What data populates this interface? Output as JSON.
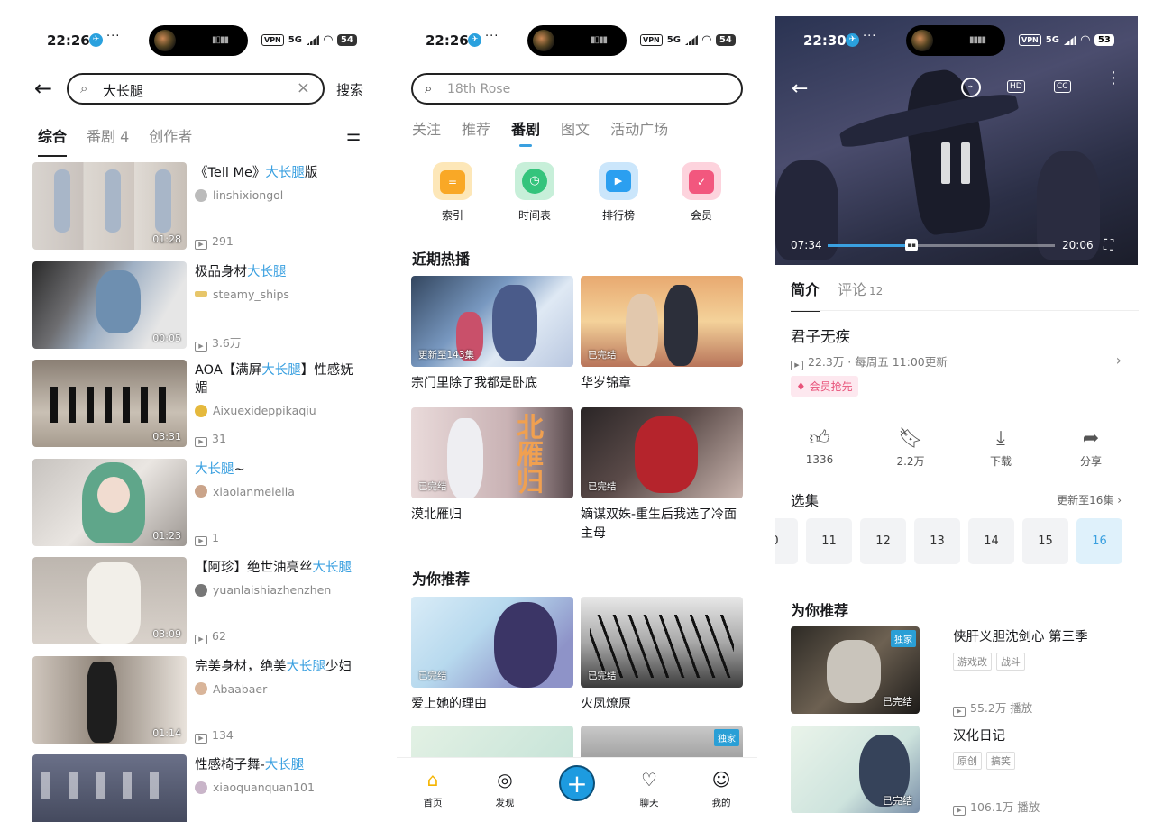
{
  "left": {
    "status": {
      "time": "22:26",
      "network": "5G",
      "battery": "54"
    },
    "search": {
      "query": "大长腿",
      "button": "搜索"
    },
    "tabs": [
      {
        "label": "综合"
      },
      {
        "label": "番剧 4"
      },
      {
        "label": "创作者"
      }
    ],
    "results": [
      {
        "title_pre": "《Tell Me》",
        "title_hl": "大长腿",
        "title_post": "版",
        "author": "linshixiongol",
        "plays": "291",
        "duration": "01:28"
      },
      {
        "title_pre": "极品身材",
        "title_hl": "大长腿",
        "title_post": "",
        "author": "steamy_ships",
        "plays": "3.6万",
        "duration": "00:05"
      },
      {
        "title_pre": "AOA【满屏",
        "title_hl": "大长腿",
        "title_post": "】性感妩媚",
        "author": "Aixuexideppikaqiu",
        "plays": "31",
        "duration": "03:31"
      },
      {
        "title_pre": "",
        "title_hl": "大长腿",
        "title_post": "~",
        "author": "xiaolanmeiella",
        "plays": "1",
        "duration": "01:23"
      },
      {
        "title_pre": "【阿珍】绝世油亮丝",
        "title_hl": "大长腿",
        "title_post": "",
        "author": "yuanlaishiazhenzhen",
        "plays": "62",
        "duration": "03:09"
      },
      {
        "title_pre": "完美身材，绝美",
        "title_hl": "大长腿",
        "title_post": "少妇",
        "author": "Abaabaer",
        "plays": "134",
        "duration": "01:14"
      },
      {
        "title_pre": "性感椅子舞-",
        "title_hl": "大长腿",
        "title_post": "",
        "author": "xiaoquanquan101",
        "plays": "",
        "duration": ""
      }
    ]
  },
  "middle": {
    "status": {
      "time": "22:26",
      "network": "5G",
      "battery": "54"
    },
    "search": {
      "placeholder": "18th Rose"
    },
    "tabs": [
      {
        "label": "关注"
      },
      {
        "label": "推荐"
      },
      {
        "label": "番剧"
      },
      {
        "label": "图文"
      },
      {
        "label": "活动广场"
      }
    ],
    "quick": [
      {
        "label": "索引",
        "color": "#f9a826"
      },
      {
        "label": "时间表",
        "color": "#34c47c"
      },
      {
        "label": "排行榜",
        "color": "#2b9ff0"
      },
      {
        "label": "会员",
        "color": "#f2577e"
      }
    ],
    "hot_title": "近期热播",
    "hot": [
      {
        "title": "宗门里除了我都是卧底",
        "badge": "更新至143集"
      },
      {
        "title": "华岁锦章",
        "badge": "已完结"
      },
      {
        "title": "漠北雁归",
        "badge": "已完结"
      },
      {
        "title": "嫡谋双姝-重生后我选了冷面主母",
        "badge": "已完结"
      }
    ],
    "rec_title": "为你推荐",
    "rec": [
      {
        "title": "爱上她的理由",
        "badge": "已完结"
      },
      {
        "title": "火凤燎原",
        "badge": "已完结"
      },
      {
        "title": "",
        "badge": ""
      },
      {
        "title": "",
        "badge": "独家"
      }
    ],
    "nav": [
      {
        "label": "首页"
      },
      {
        "label": "发现"
      },
      {
        "label": "聊天"
      },
      {
        "label": "我的"
      }
    ]
  },
  "right": {
    "status": {
      "time": "22:30",
      "network": "5G",
      "battery": "53"
    },
    "player": {
      "current": "07:34",
      "total": "20:06",
      "progress": 0.37,
      "hd": "HD",
      "cc": "CC"
    },
    "tabs": {
      "intro": "简介",
      "comments": "评论",
      "comments_count": "12"
    },
    "show_title": "君子无疾",
    "meta": "22.3万 · 每周五 11:00更新",
    "vip_badge": "会员抢先",
    "actions": [
      {
        "label": "1336",
        "icon": "thumbs-up"
      },
      {
        "label": "2.2万",
        "icon": "bookmark"
      },
      {
        "label": "下载",
        "icon": "download"
      },
      {
        "label": "分享",
        "icon": "share"
      }
    ],
    "episodes_title": "选集",
    "episodes_update": "更新至16集",
    "episodes": [
      "0",
      "11",
      "12",
      "13",
      "14",
      "15",
      "16"
    ],
    "current_episode": "16",
    "rec_title": "为你推荐",
    "rec": [
      {
        "title": "侠肝义胆沈剑心 第三季",
        "tags": [
          "游戏改",
          "战斗"
        ],
        "plays": "55.2万 播放",
        "badge": "已完结",
        "exclusive": "独家"
      },
      {
        "title": "汉化日记",
        "tags": [
          "原创",
          "搞笑"
        ],
        "plays": "106.1万 播放",
        "badge": "已完结",
        "exclusive": ""
      }
    ]
  }
}
